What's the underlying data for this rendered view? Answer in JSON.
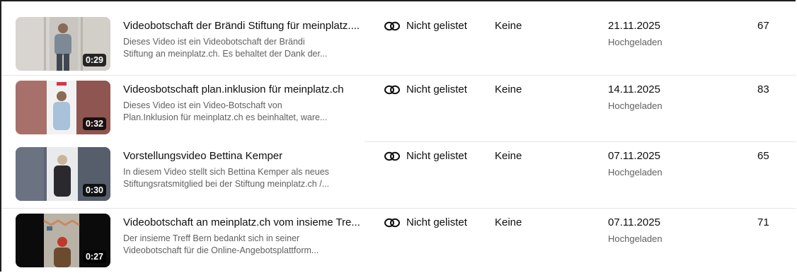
{
  "videos": [
    {
      "title": "Videobotschaft der Brändi Stiftung für meinplatz....",
      "desc_line1": "Dieses Video ist ein Videobotschaft der Brändi",
      "desc_line2": "Stiftung an meinplatz.ch. Es behaltet der Dank der...",
      "duration": "0:29",
      "visibility": "Nicht gelistet",
      "visibility_icon": "link-icon",
      "restrictions": "Keine",
      "date": "21.11.2025",
      "date_status": "Hochgeladen",
      "views": "67"
    },
    {
      "title": "Videosbotschaft plan.inklusion für meinplatz.ch",
      "desc_line1": "Dieses Video ist ein Video-Botschaft von",
      "desc_line2": "Plan.Inklusion für meinplatz.ch es beinhaltet, ware...",
      "duration": "0:32",
      "visibility": "Nicht gelistet",
      "visibility_icon": "link-icon",
      "restrictions": "Keine",
      "date": "14.11.2025",
      "date_status": "Hochgeladen",
      "views": "83"
    },
    {
      "title": "Vorstellungsvideo Bettina Kemper",
      "desc_line1": "In diesem Video stellt sich Bettina Kemper als neues",
      "desc_line2": "Stiftungsratsmitglied bei der Stiftung meinplatz.ch /...",
      "duration": "0:30",
      "visibility": "Nicht gelistet",
      "visibility_icon": "link-icon",
      "restrictions": "Keine",
      "date": "07.11.2025",
      "date_status": "Hochgeladen",
      "views": "65"
    },
    {
      "title": "Videobotschaft an meinplatz.ch vom insieme Tre...",
      "desc_line1": "Der insieme Treff Bern bedankt sich in seiner",
      "desc_line2": "Videobotschaft für die Online-Angebotsplattform...",
      "duration": "0:27",
      "visibility": "Nicht gelistet",
      "visibility_icon": "link-icon",
      "restrictions": "Keine",
      "date": "07.11.2025",
      "date_status": "Hochgeladen",
      "views": "71"
    }
  ]
}
